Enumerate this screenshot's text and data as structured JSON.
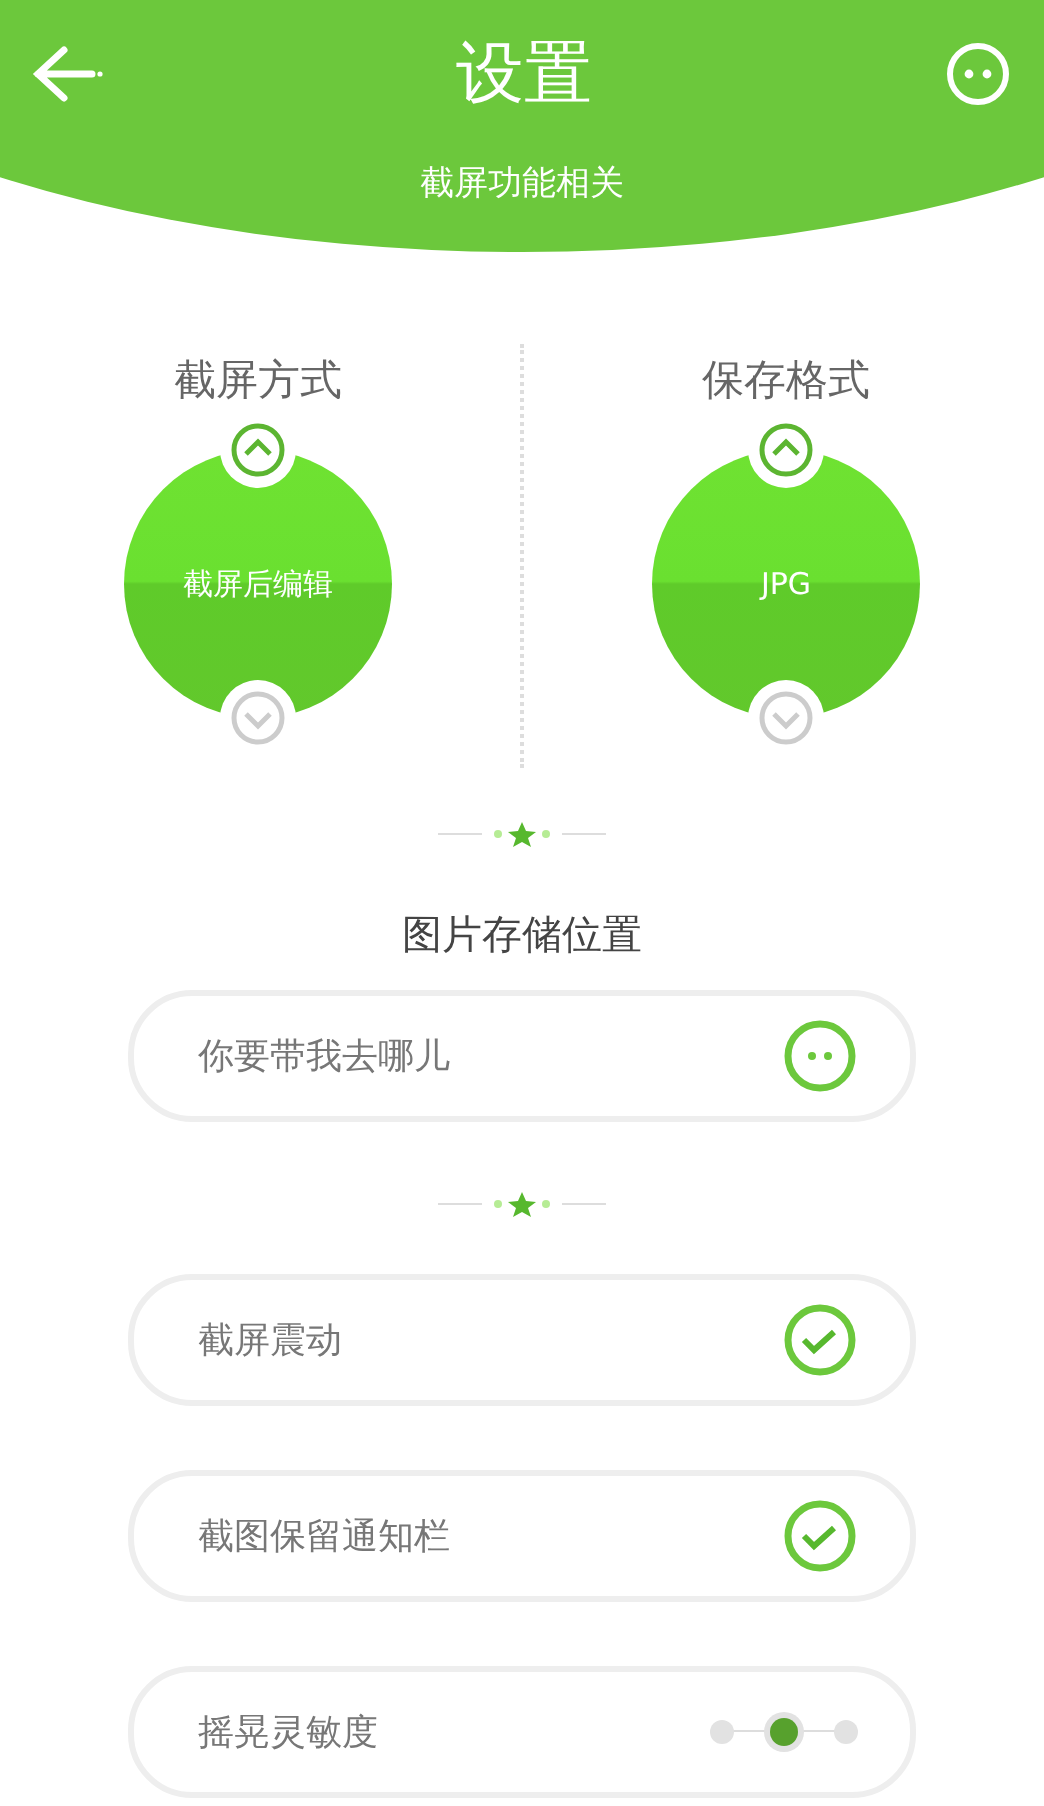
{
  "header": {
    "title": "设置",
    "subtitle": "截屏功能相关"
  },
  "dials": [
    {
      "title": "截屏方式",
      "value": "截屏后编辑"
    },
    {
      "title": "保存格式",
      "value": "JPG"
    }
  ],
  "storage": {
    "title": "图片存储位置",
    "placeholder": "你要带我去哪儿"
  },
  "settings": [
    {
      "kind": "toggle",
      "label": "截屏震动",
      "checked": true
    },
    {
      "kind": "toggle",
      "label": "截图保留通知栏",
      "checked": true
    },
    {
      "kind": "slider",
      "label": "摇晃灵敏度",
      "level": 0.5
    }
  ]
}
